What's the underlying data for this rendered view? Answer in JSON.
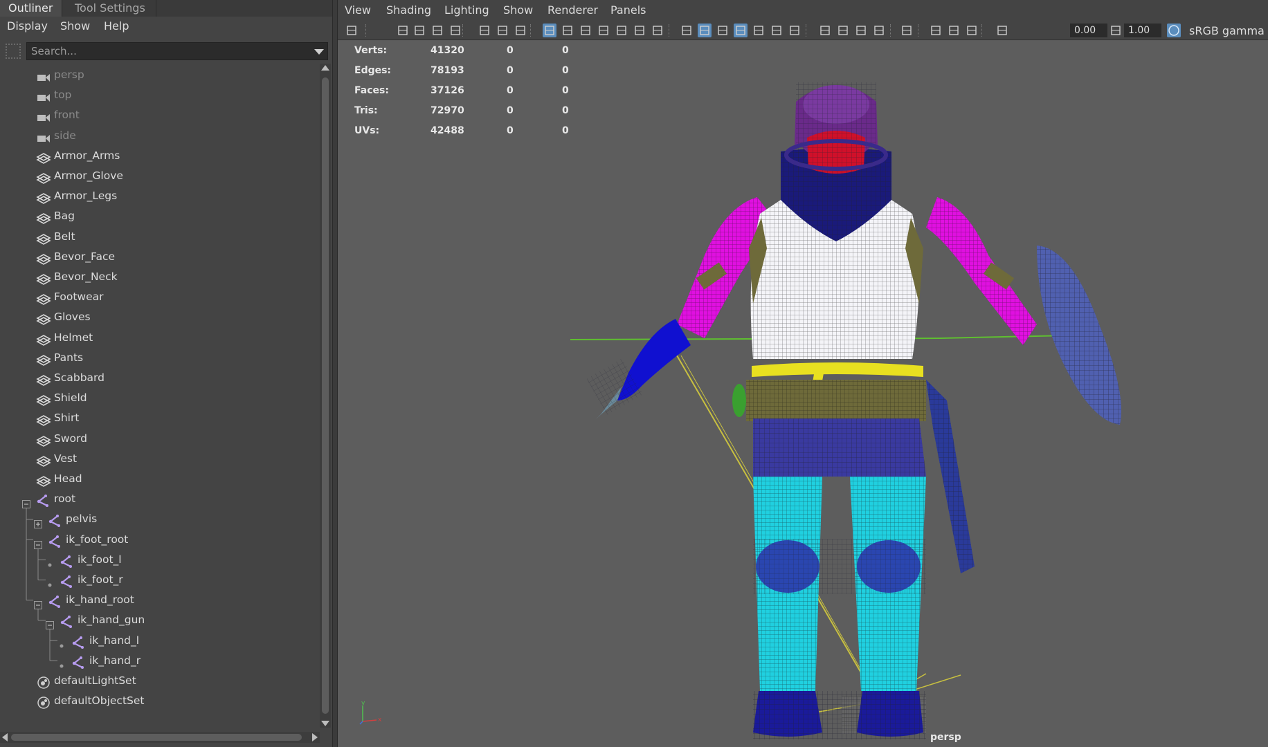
{
  "outliner": {
    "tabs": [
      {
        "label": "Outliner",
        "active": true
      },
      {
        "label": "Tool Settings",
        "active": false
      }
    ],
    "menu": [
      "Display",
      "Show",
      "Help"
    ],
    "search": {
      "placeholder": "Search..."
    },
    "items": [
      {
        "label": "persp",
        "icon": "camera-icon",
        "dim": true,
        "indent": 0
      },
      {
        "label": "top",
        "icon": "camera-icon",
        "dim": true,
        "indent": 0
      },
      {
        "label": "front",
        "icon": "camera-icon",
        "dim": true,
        "indent": 0
      },
      {
        "label": "side",
        "icon": "camera-icon",
        "dim": true,
        "indent": 0
      },
      {
        "label": "Armor_Arms",
        "icon": "mesh-icon",
        "indent": 0
      },
      {
        "label": "Armor_Glove",
        "icon": "mesh-icon",
        "indent": 0
      },
      {
        "label": "Armor_Legs",
        "icon": "mesh-icon",
        "indent": 0
      },
      {
        "label": "Bag",
        "icon": "mesh-icon",
        "indent": 0
      },
      {
        "label": "Belt",
        "icon": "mesh-icon",
        "indent": 0
      },
      {
        "label": "Bevor_Face",
        "icon": "mesh-icon",
        "indent": 0
      },
      {
        "label": "Bevor_Neck",
        "icon": "mesh-icon",
        "indent": 0
      },
      {
        "label": "Footwear",
        "icon": "mesh-icon",
        "indent": 0
      },
      {
        "label": "Gloves",
        "icon": "mesh-icon",
        "indent": 0
      },
      {
        "label": "Helmet",
        "icon": "mesh-icon",
        "indent": 0
      },
      {
        "label": "Pants",
        "icon": "mesh-icon",
        "indent": 0
      },
      {
        "label": "Scabbard",
        "icon": "mesh-icon",
        "indent": 0
      },
      {
        "label": "Shield",
        "icon": "mesh-icon",
        "indent": 0
      },
      {
        "label": "Shirt",
        "icon": "mesh-icon",
        "indent": 0
      },
      {
        "label": "Sword",
        "icon": "mesh-icon",
        "indent": 0
      },
      {
        "label": "Vest",
        "icon": "mesh-icon",
        "indent": 0
      },
      {
        "label": "Head",
        "icon": "mesh-icon",
        "indent": 0
      },
      {
        "label": "root",
        "icon": "joint-icon",
        "indent": 0,
        "expander": "minus"
      },
      {
        "label": "pelvis",
        "icon": "joint-icon",
        "indent": 1,
        "expander": "plus"
      },
      {
        "label": "ik_foot_root",
        "icon": "joint-icon",
        "indent": 1,
        "expander": "minus"
      },
      {
        "label": "ik_foot_l",
        "icon": "joint-icon",
        "indent": 2,
        "expander": "dot"
      },
      {
        "label": "ik_foot_r",
        "icon": "joint-icon",
        "indent": 2,
        "expander": "dot"
      },
      {
        "label": "ik_hand_root",
        "icon": "joint-icon",
        "indent": 1,
        "expander": "minus"
      },
      {
        "label": "ik_hand_gun",
        "icon": "joint-icon",
        "indent": 2,
        "expander": "minus"
      },
      {
        "label": "ik_hand_l",
        "icon": "joint-icon",
        "indent": 3,
        "expander": "dot"
      },
      {
        "label": "ik_hand_r",
        "icon": "joint-icon",
        "indent": 3,
        "expander": "dot"
      },
      {
        "label": "defaultLightSet",
        "icon": "set-icon",
        "indent": 0
      },
      {
        "label": "defaultObjectSet",
        "icon": "set-icon",
        "indent": 0
      }
    ]
  },
  "viewport": {
    "menu": [
      "View",
      "Shading",
      "Lighting",
      "Show",
      "Renderer",
      "Panels"
    ],
    "exposure": "0.00",
    "gamma": "1.00",
    "color_space": "sRGB gamma",
    "camera": "persp",
    "axis_labels": {
      "y": "y",
      "x": "x"
    },
    "hud": [
      {
        "label": "Verts:",
        "v1": "41320",
        "v2": "0",
        "v3": "0"
      },
      {
        "label": "Edges:",
        "v1": "78193",
        "v2": "0",
        "v3": "0"
      },
      {
        "label": "Faces:",
        "v1": "37126",
        "v2": "0",
        "v3": "0"
      },
      {
        "label": "Tris:",
        "v1": "72970",
        "v2": "0",
        "v3": "0"
      },
      {
        "label": "UVs:",
        "v1": "42488",
        "v2": "0",
        "v3": "0"
      }
    ]
  },
  "colors": {
    "helmet": "#6a2a8a",
    "visor": "#d0102a",
    "arms": "#e010e0",
    "vest": "#f4f4f8",
    "gloves": "#1010d0",
    "belt": "#e8e020",
    "legs": "#20d0e0",
    "boots": "#1a1a9a",
    "shield": "#5060b0",
    "ik_lines": "#c8c040"
  }
}
